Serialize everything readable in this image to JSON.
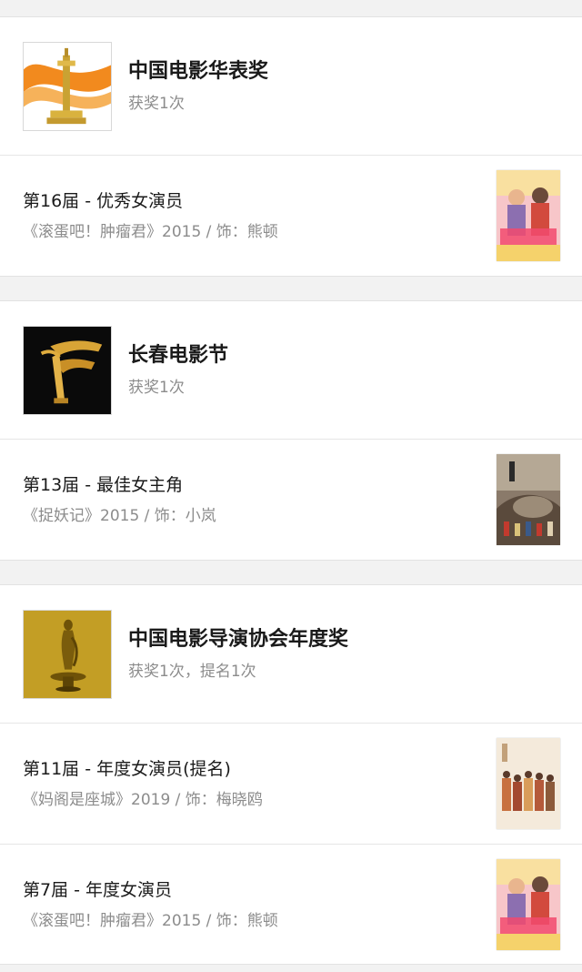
{
  "awards": [
    {
      "name": "中国电影华表奖",
      "count": "获奖1次",
      "logo_icon": "huabiao-pillar-icon",
      "entries": [
        {
          "title": "第16届 - 优秀女演员",
          "subtitle": "《滚蛋吧！肿瘤君》2015 / 饰：熊顿",
          "poster_icon": "poster-gundan-icon"
        }
      ]
    },
    {
      "name": "长春电影节",
      "count": "获奖1次",
      "logo_icon": "golden-deer-trophy-icon",
      "entries": [
        {
          "title": "第13届 - 最佳女主角",
          "subtitle": "《捉妖记》2015 / 饰：小岚",
          "poster_icon": "poster-zhuoyaoji-icon"
        }
      ]
    },
    {
      "name": "中国电影导演协会年度奖",
      "count": "获奖1次，提名1次",
      "logo_icon": "golden-statue-icon",
      "entries": [
        {
          "title": "第11届 - 年度女演员(提名)",
          "subtitle": "《妈阁是座城》2019 / 饰：梅晓鸥",
          "poster_icon": "poster-mage-icon"
        },
        {
          "title": "第7届 - 年度女演员",
          "subtitle": "《滚蛋吧！肿瘤君》2015 / 饰：熊顿",
          "poster_icon": "poster-gundan-icon"
        }
      ]
    }
  ]
}
